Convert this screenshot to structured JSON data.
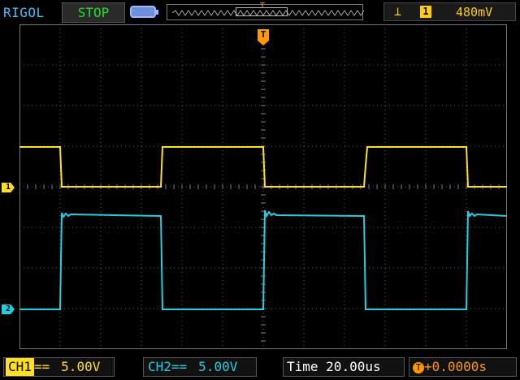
{
  "header": {
    "brand": "RIGOL",
    "run_state": "STOP",
    "trigger_marker": "T",
    "trigger_edge_symbol": "⊥",
    "trigger_source": "1",
    "trigger_level": "480mV"
  },
  "channels": {
    "ch1": {
      "marker": "1",
      "color": "#ffe020"
    },
    "ch2": {
      "marker": "2",
      "color": "#20d0e0"
    }
  },
  "trigger_position_marker": "T",
  "footer": {
    "ch1_label": "CH1",
    "ch1_coupling": "==",
    "ch1_scale": "5.00V",
    "ch2_label": "CH2",
    "ch2_coupling": "==",
    "ch2_scale": "5.00V",
    "time_label": "Time",
    "time_scale": "20.00us",
    "offset_icon": "T",
    "offset_value": "+0.0000s"
  },
  "colors": {
    "grid": "#5a5a5a",
    "ch1": "#ffe020",
    "ch2": "#20d0e0",
    "trigger": "#ff9900"
  }
}
